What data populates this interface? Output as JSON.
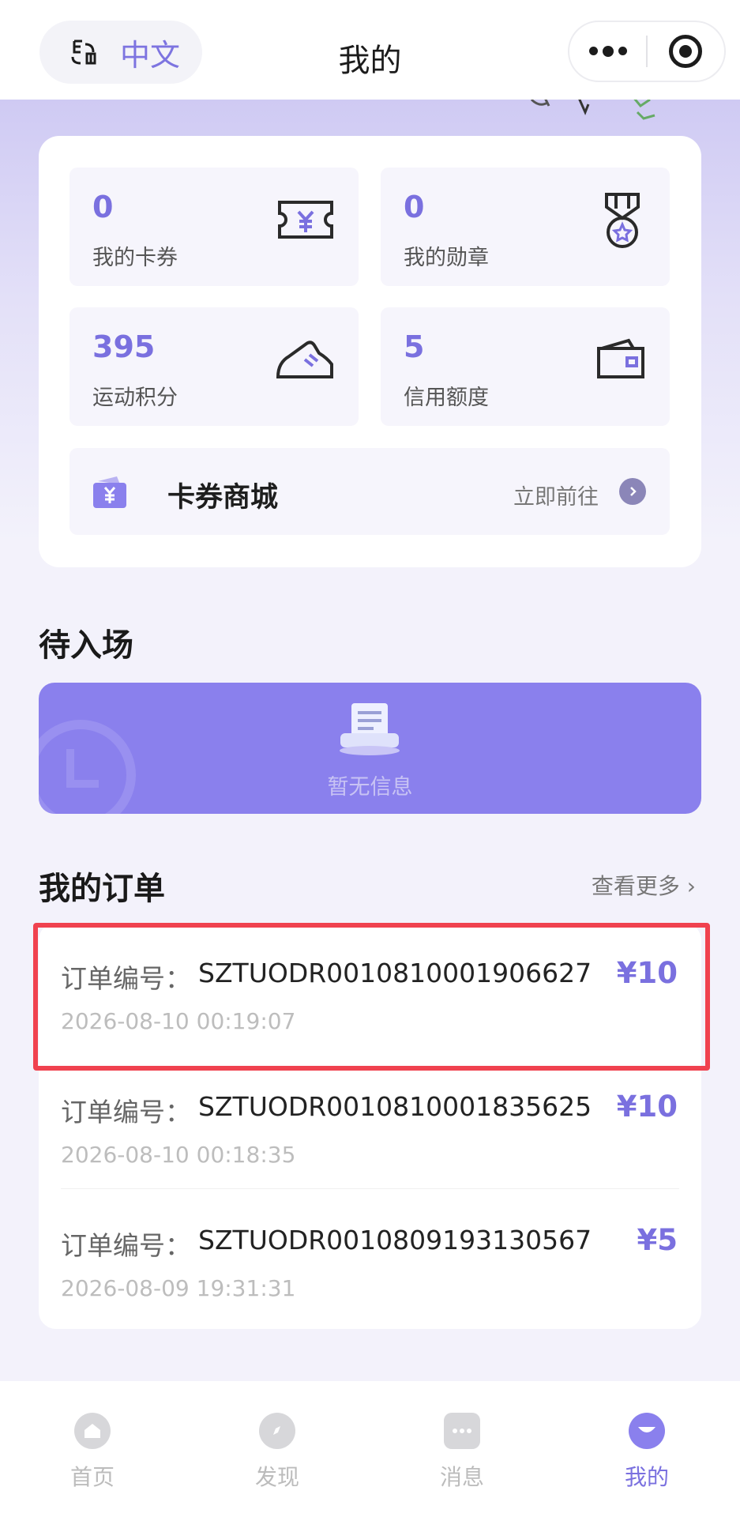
{
  "header": {
    "lang_label": "中文",
    "title": "我的"
  },
  "stats": [
    {
      "value": "0",
      "label": "我的卡券",
      "icon": "ticket-icon"
    },
    {
      "value": "0",
      "label": "我的勋章",
      "icon": "medal-icon"
    },
    {
      "value": "395",
      "label": "运动积分",
      "icon": "sneaker-icon"
    },
    {
      "value": "5",
      "label": "信用额度",
      "icon": "wallet-icon"
    }
  ],
  "coupon_mall": {
    "title": "卡券商城",
    "action_label": "立即前往"
  },
  "pending": {
    "title": "待入场",
    "empty_text": "暂无信息"
  },
  "orders": {
    "title": "我的订单",
    "more_label": "查看更多 ›",
    "items": [
      {
        "label": "订单编号：",
        "number": "SZTUODR0010810001906627",
        "price": "¥10",
        "time": "2026-08-10 00:19:07"
      },
      {
        "label": "订单编号：",
        "number": "SZTUODR0010810001835625",
        "price": "¥10",
        "time": "2026-08-10 00:18:35"
      },
      {
        "label": "订单编号：",
        "number": "SZTUODR0010809193130567",
        "price": "¥5",
        "time": "2026-08-09 19:31:31"
      }
    ]
  },
  "tabbar": {
    "items": [
      {
        "label": "首页",
        "icon": "home-icon"
      },
      {
        "label": "发现",
        "icon": "compass-icon"
      },
      {
        "label": "消息",
        "icon": "message-icon"
      },
      {
        "label": "我的",
        "icon": "profile-icon"
      }
    ],
    "active_index": 3
  },
  "colors": {
    "accent": "#7a70df",
    "banner": "#8a80ed",
    "highlight": "#f0424f"
  }
}
